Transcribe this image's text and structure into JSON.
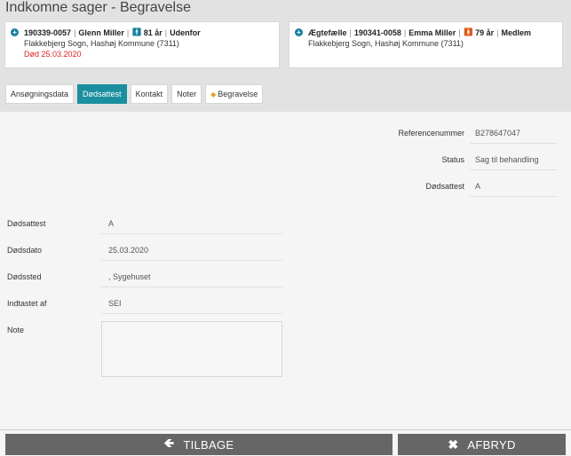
{
  "page": {
    "title": "Indkomne sager - Begravelse"
  },
  "applicant": {
    "cpr": "190339-0057",
    "name": "Glenn Miller",
    "age": "81 år",
    "status": "Udenfor",
    "location": "Flakkebjerg Sogn, Hashøj Kommune (7311)",
    "death": "Død 25.03.2020"
  },
  "spouse": {
    "relation": "Ægtefælle",
    "cpr": "190341-0058",
    "name": "Emma Miller",
    "age": "79 år",
    "status": "Medlem",
    "location": "Flakkebjerg Sogn, Hashøj Kommune (7311)"
  },
  "tabs": [
    {
      "label": "Ansøgningsdata"
    },
    {
      "label": "Dødsattest"
    },
    {
      "label": "Kontakt"
    },
    {
      "label": "Noter"
    },
    {
      "label": "Begravelse"
    }
  ],
  "summary": {
    "ref_label": "Referencenummer",
    "ref_value": "B278647047",
    "status_label": "Status",
    "status_value": "Sag til behandling",
    "cert_label": "Dødsattest",
    "cert_value": "A"
  },
  "form": {
    "cert_label": "Dødsattest",
    "cert_value": "A",
    "date_label": "Dødsdato",
    "date_value": "25.03.2020",
    "place_label": "Dødssted",
    "place_value": ", Sygehuset",
    "entered_label": "Indtastet af",
    "entered_value": "SEI",
    "note_label": "Note",
    "note_value": ""
  },
  "footer": {
    "back_label": "TILBAGE",
    "cancel_label": "AFBRYD"
  },
  "icons": {
    "back": "arrow-left-icon",
    "cancel": "close-icon",
    "expand": "plus-circle-icon"
  }
}
